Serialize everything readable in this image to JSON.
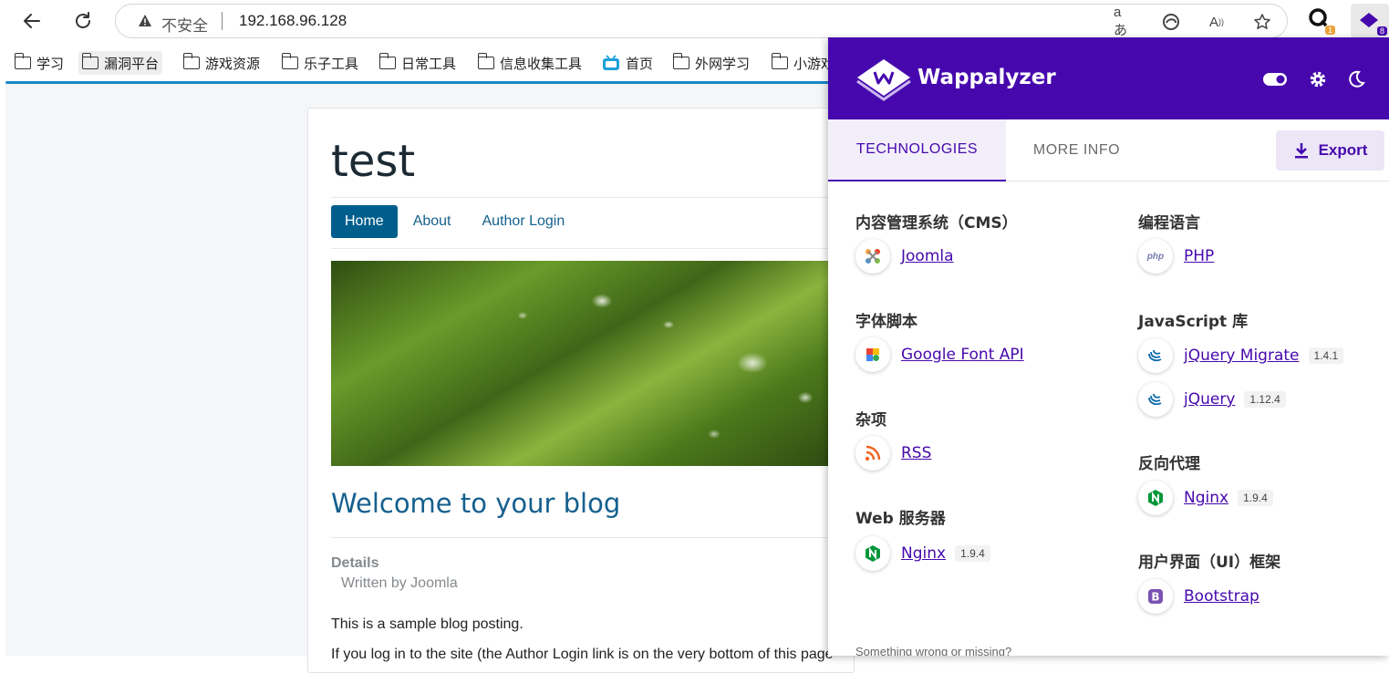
{
  "browser": {
    "address": {
      "security_label": "不安全",
      "url": "192.168.96.128"
    },
    "extensions": [
      {
        "name": "extension-one",
        "badge": "1",
        "badge_color": "#e8a33b"
      },
      {
        "name": "wappalyzer-extension",
        "badge": "8",
        "badge_color": "#4608ad"
      }
    ],
    "bookmarks": [
      "学习",
      "漏洞平台",
      "游戏资源",
      "乐子工具",
      "日常工具",
      "信息收集工具",
      "首页",
      "外网学习",
      "小游戏"
    ]
  },
  "page": {
    "site_title": "test",
    "menu": [
      "Home",
      "About",
      "Author Login"
    ],
    "post_title": "Welcome to your blog",
    "details_heading": "Details",
    "written_by": "Written by Joomla",
    "paragraph1": "This is a sample blog posting.",
    "paragraph2": "If you log in to the site (the Author Login link is on the very bottom of this page"
  },
  "wappalyzer": {
    "brand": "Wappalyzer",
    "brand_color": "#4608ad",
    "tabs": {
      "technologies": "TECHNOLOGIES",
      "more_info": "MORE INFO"
    },
    "export_label": "Export",
    "left": [
      {
        "category": "内容管理系统（CMS）",
        "techs": [
          {
            "name": "Joomla",
            "version": "",
            "icon": "joomla-icon"
          }
        ]
      },
      {
        "category": "字体脚本",
        "techs": [
          {
            "name": "Google Font API",
            "version": "",
            "icon": "google-font-icon"
          }
        ]
      },
      {
        "category": "杂项",
        "techs": [
          {
            "name": "RSS",
            "version": "",
            "icon": "rss-icon"
          }
        ]
      },
      {
        "category": "Web 服务器",
        "techs": [
          {
            "name": "Nginx",
            "version": "1.9.4",
            "icon": "nginx-icon"
          }
        ]
      }
    ],
    "right": [
      {
        "category": "编程语言",
        "techs": [
          {
            "name": "PHP",
            "version": "",
            "icon": "php-icon"
          }
        ]
      },
      {
        "category": "JavaScript 库",
        "techs": [
          {
            "name": "jQuery Migrate",
            "version": "1.4.1",
            "icon": "jquery-icon"
          },
          {
            "name": "jQuery",
            "version": "1.12.4",
            "icon": "jquery-icon"
          }
        ]
      },
      {
        "category": "反向代理",
        "techs": [
          {
            "name": "Nginx",
            "version": "1.9.4",
            "icon": "nginx-icon"
          }
        ]
      },
      {
        "category": "用户界面（UI）框架",
        "techs": [
          {
            "name": "Bootstrap",
            "version": "",
            "icon": "bootstrap-icon"
          }
        ]
      }
    ],
    "footer": "Something wrong or missing?"
  }
}
